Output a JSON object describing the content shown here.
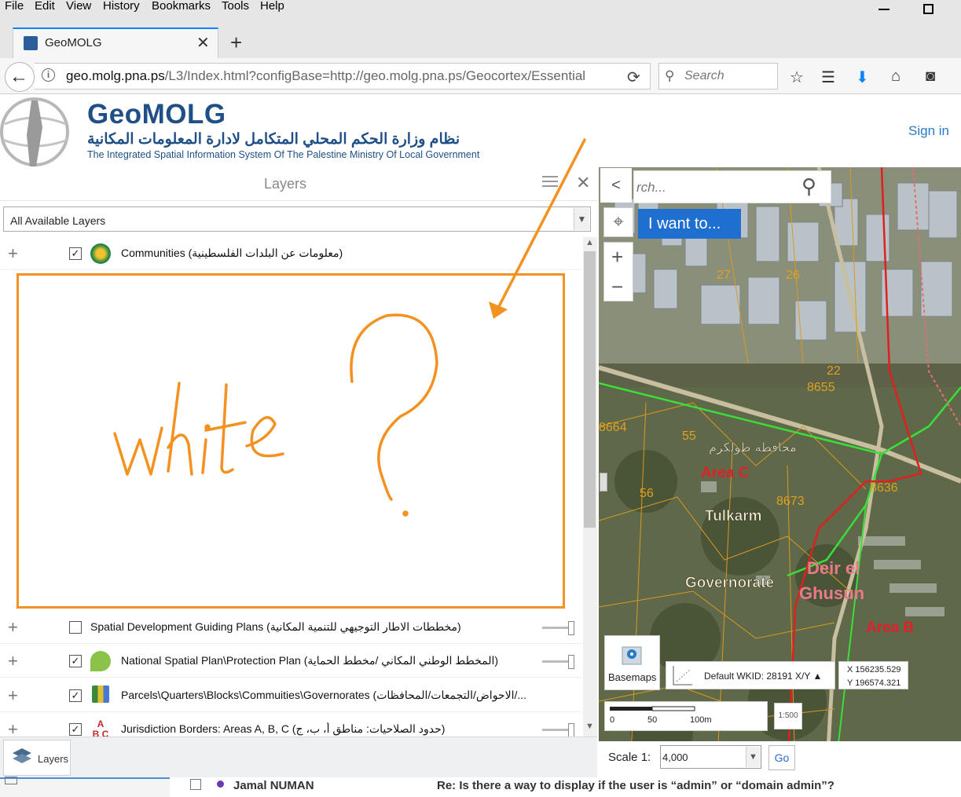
{
  "menubar": {
    "items": [
      "File",
      "Edit",
      "View",
      "History",
      "Bookmarks",
      "Tools",
      "Help"
    ]
  },
  "tab": {
    "title": "GeoMOLG"
  },
  "url": {
    "host": "geo.molg.pna.ps",
    "path": "/L3/Index.html?configBase=http://geo.molg.pna.ps/Geocortex/Essential"
  },
  "search": {
    "placeholder": "Search"
  },
  "header": {
    "brand": "GeoMOLG",
    "brand_arabic": "نظام وزارة الحكم المحلي المتكامل لادارة المعلومات المكانية",
    "brand_english": "The Integrated Spatial Information System Of The Palestine Ministry Of Local Government",
    "sign_in": "Sign in"
  },
  "layers_panel": {
    "title": "Layers",
    "select_value": "All Available Layers",
    "rows": [
      {
        "label": "Communities (معلومات عن البلدات الفلسطينية)",
        "checked": true
      },
      {
        "label": "Spatial Development Guiding Plans (مخططات الاطار التوجيهي للتنمية المكانية)",
        "checked": false
      },
      {
        "label": "National Spatial Plan\\Protection Plan (المخطط الوطني المكاني /مخطط الحماية)",
        "checked": true
      },
      {
        "label": "Parcels\\Quarters\\Blocks\\Commuities\\Governorates (الاحواض/التجمعات/المحافظات/...",
        "checked": true
      },
      {
        "label": "Jurisdiction Borders: Areas A, B, C (حدود الصلاحيات: مناطق أ، ب، ج)",
        "checked": true
      }
    ],
    "bottom_tab": "Layers"
  },
  "map": {
    "search_placeholder": "rch...",
    "i_want_to": "I want to...",
    "basemaps": "Basemaps",
    "wkid": "Default WKID: 28191 X/Y ▲",
    "x": "X  156235.529",
    "y": "Y  196574.321",
    "scale_label": "Scale 1:",
    "scale_value": "4,000",
    "go": "Go",
    "scalebar_ticks": [
      "0",
      "50",
      "100m"
    ],
    "scale_button": "1:500",
    "labels": [
      {
        "text": "Tulkarm",
        "color": "#f2ecc8"
      },
      {
        "text": "Governorate",
        "color": "#f2ecc8"
      },
      {
        "text": "Area C",
        "color": "#e0202a"
      },
      {
        "text": "Area B",
        "color": "#e0202a"
      },
      {
        "text": "Deir el",
        "color": "#e87a8a"
      },
      {
        "text": "Ghusun",
        "color": "#e87a8a"
      },
      {
        "text": "محافظة طولكرم",
        "color": "#f2ecc8"
      },
      {
        "text": "22",
        "color": "#e0a020"
      },
      {
        "text": "8655",
        "color": "#e0a020"
      },
      {
        "text": "27",
        "color": "#e0a020"
      },
      {
        "text": "26",
        "color": "#e0a020"
      },
      {
        "text": "8664",
        "color": "#e0a020"
      },
      {
        "text": "55",
        "color": "#e0a020"
      },
      {
        "text": "8673",
        "color": "#e0a020"
      },
      {
        "text": "56",
        "color": "#e0a020"
      },
      {
        "text": "8636",
        "color": "#e0a020"
      }
    ]
  },
  "annotation": {
    "text": "White",
    "mark": "?"
  },
  "email_strip": {
    "user": "Jamal NUMAN",
    "subject": "Re: Is there a way to display if the user is “admin” or “domain admin”?"
  },
  "colors": {
    "accent": "#1f6fd0",
    "annotation": "#f39221",
    "brand": "#1f4f86"
  }
}
